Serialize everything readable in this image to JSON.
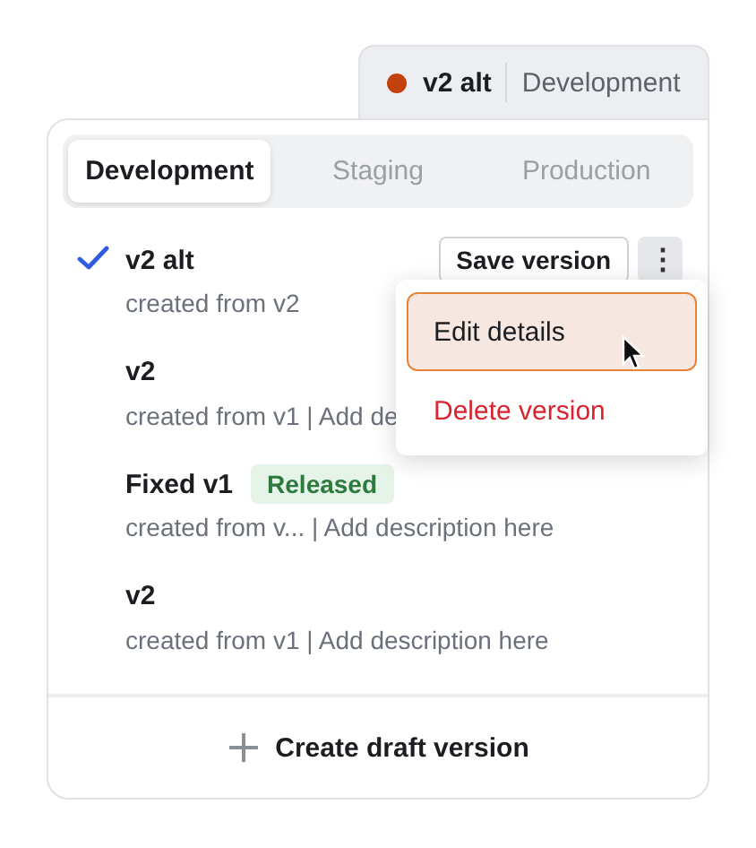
{
  "current": {
    "color": "#c2410c",
    "version": "v2 alt",
    "environment": "Development"
  },
  "tabs": [
    {
      "label": "Development",
      "selected": true
    },
    {
      "label": "Staging",
      "selected": false
    },
    {
      "label": "Production",
      "selected": false
    }
  ],
  "versions": [
    {
      "name": "v2 alt",
      "description": "created from v2",
      "selected": true,
      "save_button": "Save version",
      "more_button": "⋮"
    },
    {
      "name": "v2",
      "description": "created from v1 | Add de",
      "selected": false
    },
    {
      "name": "Fixed v1",
      "badge": "Released",
      "description": "created from v... | Add description here",
      "selected": false
    },
    {
      "name": "v2",
      "description": "created from v1 | Add description here",
      "selected": false
    }
  ],
  "menu": [
    {
      "label": "Edit details",
      "kind": "hovered"
    },
    {
      "label": "Delete version",
      "kind": "danger"
    }
  ],
  "create_button": "Create draft version"
}
